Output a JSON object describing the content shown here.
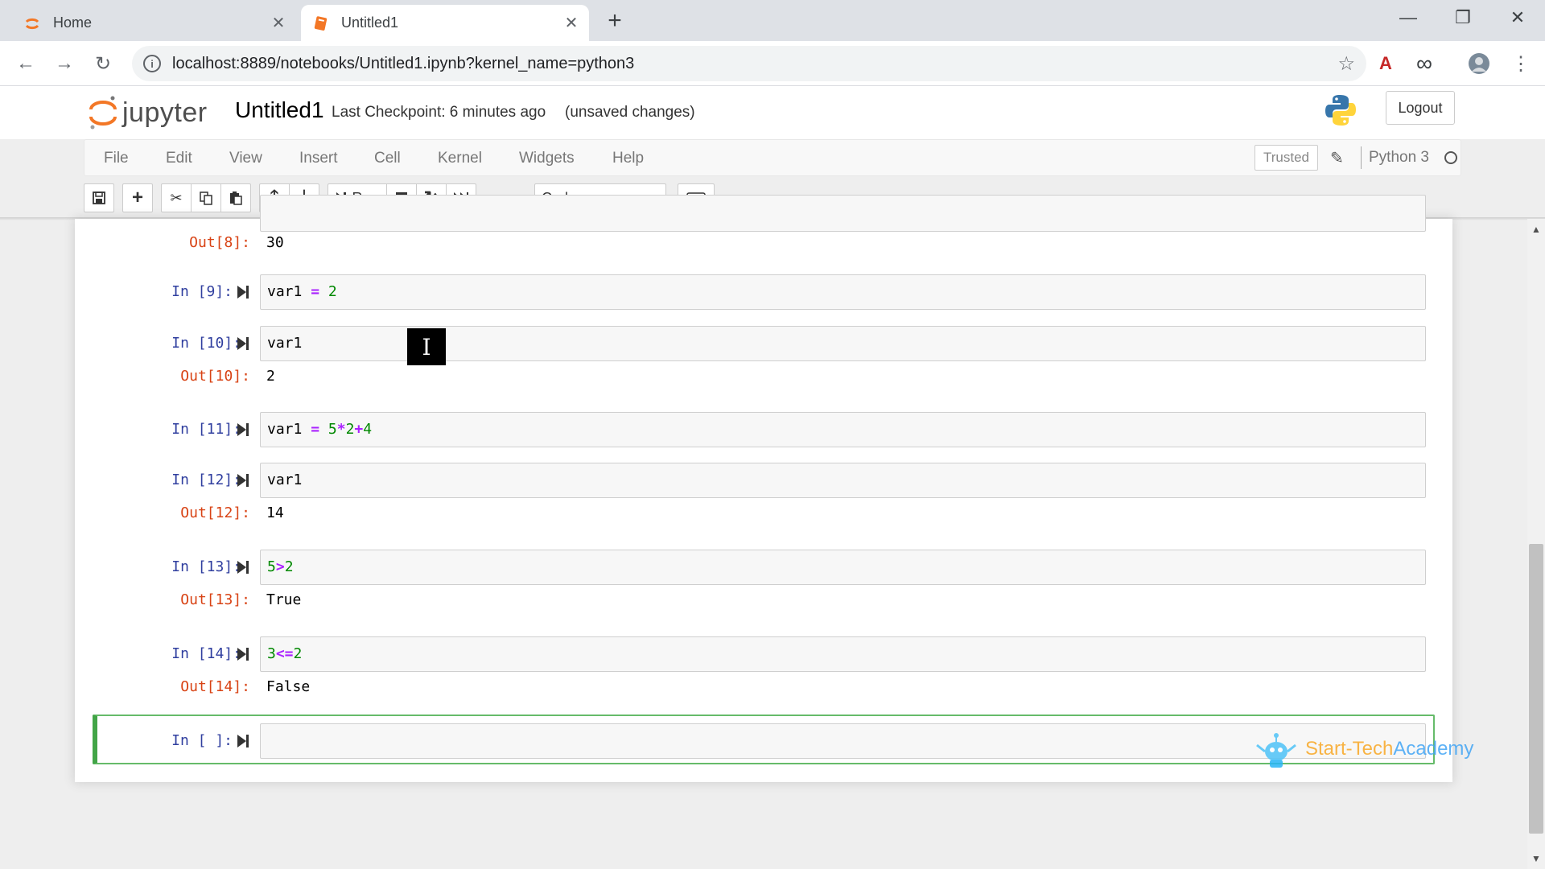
{
  "browser": {
    "tabs": [
      {
        "title": "Home",
        "close": "✕"
      },
      {
        "title": "Untitled1",
        "close": "✕"
      }
    ],
    "new_tab": "+",
    "window_controls": {
      "minimize": "—",
      "restore": "❐",
      "close": "✕"
    },
    "nav": {
      "back": "←",
      "forward": "→",
      "reload": "↻"
    },
    "url": "localhost:8889/notebooks/Untitled1.ipynb?kernel_name=python3",
    "info_icon": "i",
    "bookmark_star": "☆",
    "extensions": {
      "pdf_icon": "A",
      "infinity_icon": "∞"
    },
    "menu_dots": "⋮",
    "colors": {
      "tab_strip": "#dee1e6",
      "omnibox": "#f1f3f4"
    }
  },
  "jupyter": {
    "logo_text": "jupyter",
    "notebook_name": "Untitled1",
    "checkpoint": "Last Checkpoint: 6 minutes ago",
    "autosave_status": "(unsaved changes)",
    "logout": "Logout",
    "menu": [
      "File",
      "Edit",
      "View",
      "Insert",
      "Cell",
      "Kernel",
      "Widgets",
      "Help"
    ],
    "trusted": "Trusted",
    "kernel_name": "Python 3",
    "toolbar": {
      "run_label": "Run",
      "cell_type": "Code",
      "icons": [
        "save-icon",
        "plus-icon",
        "cut-icon",
        "copy-icon",
        "paste-icon",
        "arrow-up-icon",
        "arrow-down-icon",
        "run-icon",
        "stop-icon",
        "restart-icon",
        "fast-forward-icon",
        "keyboard-icon"
      ]
    },
    "colors": {
      "input_prompt": "#303f9f",
      "output_prompt": "#d84315",
      "selected_border": "#42a547",
      "number": "#008800",
      "operator": "#aa22ff"
    }
  },
  "cells": [
    {
      "out_prompt": "Out[8]:",
      "output": "30"
    },
    {
      "in_prompt": "In [9]:",
      "code": [
        "var1",
        " = ",
        "2"
      ]
    },
    {
      "in_prompt": "In [10]:",
      "code": [
        "var1"
      ],
      "out_prompt": "Out[10]:",
      "output": "2"
    },
    {
      "in_prompt": "In [11]:",
      "code": [
        "var1",
        " = ",
        "5",
        "*",
        "2",
        "+",
        "4"
      ]
    },
    {
      "in_prompt": "In [12]:",
      "code": [
        "var1"
      ],
      "out_prompt": "Out[12]:",
      "output": "14"
    },
    {
      "in_prompt": "In [13]:",
      "code": [
        "5",
        ">",
        "2"
      ],
      "out_prompt": "Out[13]:",
      "output": "True"
    },
    {
      "in_prompt": "In [14]:",
      "code": [
        "3",
        "<=",
        "2"
      ],
      "out_prompt": "Out[14]:",
      "output": "False"
    },
    {
      "in_prompt": "In [ ]:",
      "code": []
    }
  ],
  "cursor_glyph": "I",
  "watermark": {
    "part1": "Start-Tech",
    "part2": "Academy"
  }
}
